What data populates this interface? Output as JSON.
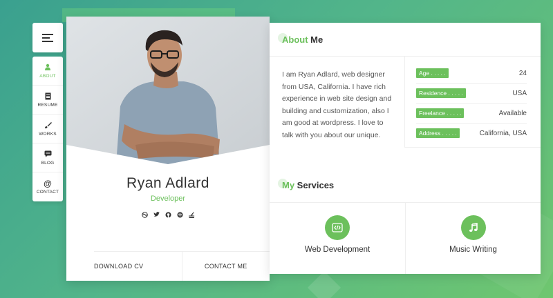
{
  "nav": {
    "items": [
      {
        "label": "ABOUT",
        "icon": "user-icon",
        "active": true
      },
      {
        "label": "RESUME",
        "icon": "document-icon",
        "active": false
      },
      {
        "label": "WORKS",
        "icon": "brush-icon",
        "active": false
      },
      {
        "label": "BLOG",
        "icon": "chat-icon",
        "active": false
      },
      {
        "label": "CONTACT",
        "icon": "at-icon",
        "active": false
      }
    ]
  },
  "profile": {
    "name": "Ryan Adlard",
    "role": "Developer",
    "socials": [
      "dribbble-icon",
      "twitter-icon",
      "github-icon",
      "spotify-icon",
      "stackoverflow-icon"
    ],
    "download_label": "DOWNLOAD CV",
    "contact_label": "CONTACT ME"
  },
  "about": {
    "title_accent": "About",
    "title_rest": " Me",
    "text": "I am Ryan Adlard, web designer from USA, California. I have rich experience in web site design and building and customization, also I am good at wordpress. I love to talk with you about our unique.",
    "info": [
      {
        "key": "Age . . . . .",
        "value": "24"
      },
      {
        "key": "Residence . . . . .",
        "value": "USA"
      },
      {
        "key": "Freelance . . . . .",
        "value": "Available"
      },
      {
        "key": "Address . . . . .",
        "value": "California, USA"
      }
    ]
  },
  "services": {
    "title_accent": "My",
    "title_rest": " Services",
    "items": [
      {
        "title": "Web Development",
        "icon": "code-icon"
      },
      {
        "title": "Music Writing",
        "icon": "music-icon"
      }
    ]
  },
  "colors": {
    "accent": "#6cc05c"
  }
}
